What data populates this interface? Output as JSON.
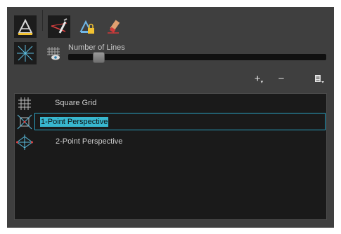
{
  "toolbar": {
    "tools": [
      {
        "icon": "ruler-triangle-icon",
        "active": true
      },
      {
        "icon": "perspective-pen-icon",
        "active": true
      },
      {
        "icon": "locked-ruler-icon",
        "active": false
      },
      {
        "icon": "eraser-ruler-icon",
        "active": false
      }
    ]
  },
  "options": {
    "number_of_lines_label": "Number of Lines",
    "number_of_lines_value": 0.1,
    "show_grid_icon": "grid-eye-icon",
    "perspective_lines_icon": "perspective-lines-icon"
  },
  "controls": {
    "add_label": "+",
    "remove_label": "−"
  },
  "guides": {
    "items": [
      {
        "label": "Square Grid",
        "icon": "square-grid-icon",
        "selected": false
      },
      {
        "label": "1-Point Perspective",
        "icon": "one-point-perspective-icon",
        "selected": true
      },
      {
        "label": "2-Point Perspective",
        "icon": "two-point-perspective-icon",
        "selected": false
      }
    ]
  },
  "colors": {
    "panel_bg": "#3f3f3f",
    "list_bg": "#1a1a1a",
    "selection": "#38b7cf"
  }
}
